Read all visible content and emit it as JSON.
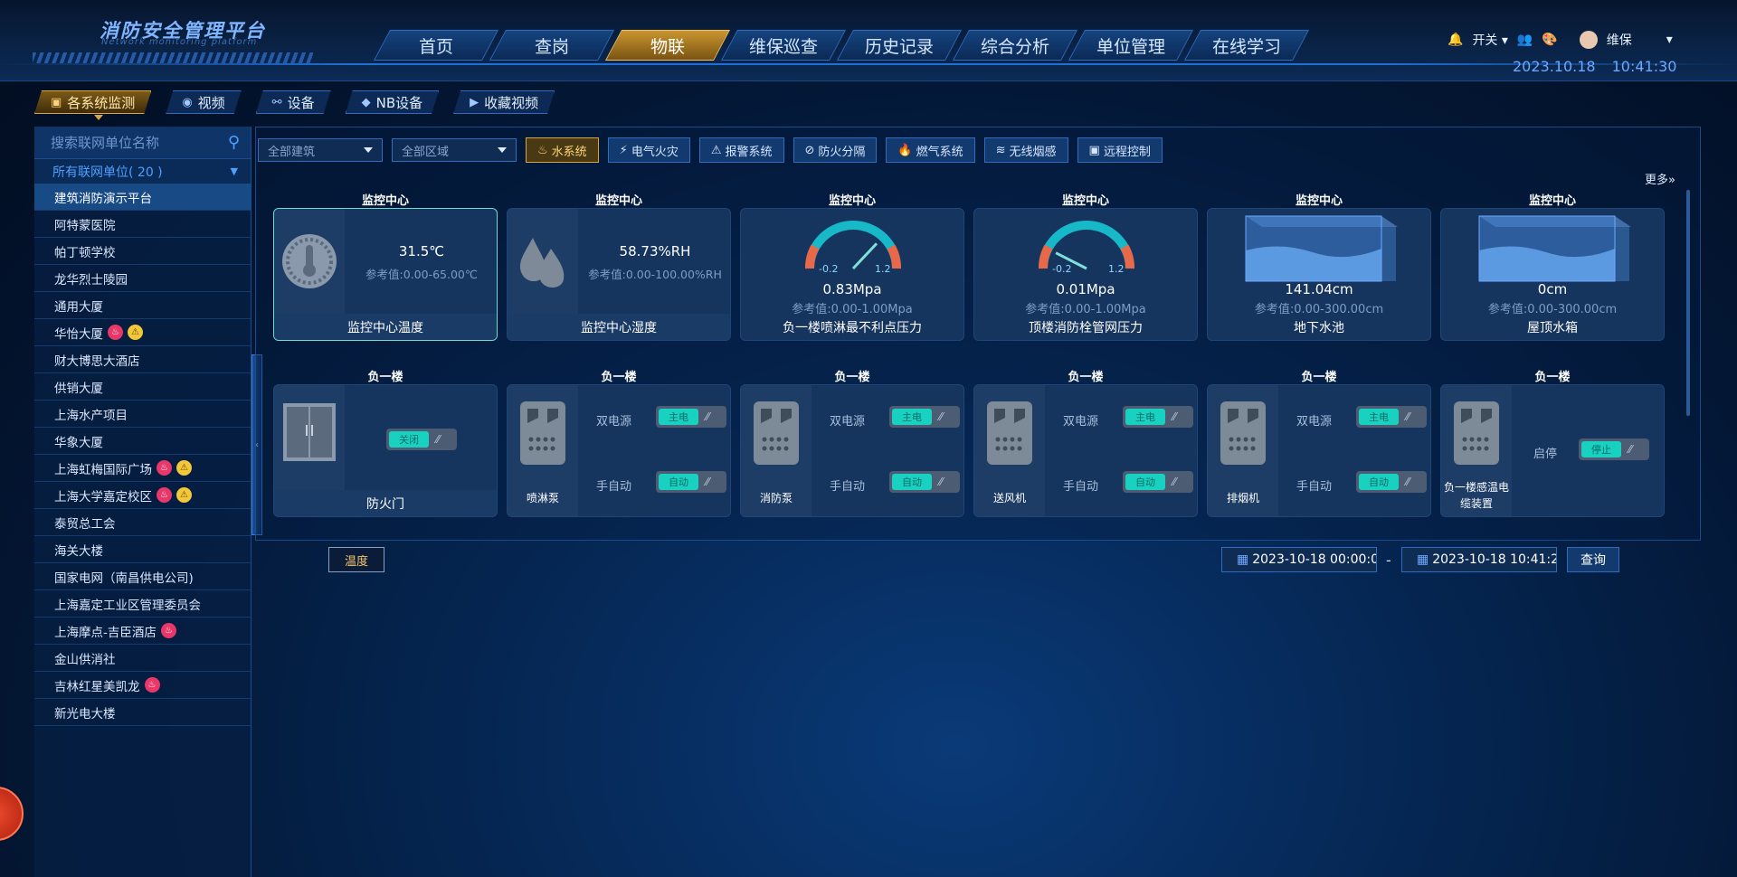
{
  "header": {
    "title": "消防安全管理平台",
    "subtitle": "Network monitoring platform",
    "user": "维保",
    "switch_label": "开关",
    "date": "2023.10.18",
    "time": "10:41:30"
  },
  "nav": [
    {
      "label": "首页"
    },
    {
      "label": "查岗"
    },
    {
      "label": "物联",
      "active": true
    },
    {
      "label": "维保巡查"
    },
    {
      "label": "历史记录"
    },
    {
      "label": "综合分析"
    },
    {
      "label": "单位管理"
    },
    {
      "label": "在线学习"
    }
  ],
  "tabs": [
    {
      "label": "各系统监测",
      "icon": "monitor-icon",
      "active": true
    },
    {
      "label": "视频",
      "icon": "camera-icon"
    },
    {
      "label": "设备",
      "icon": "network-icon"
    },
    {
      "label": "NB设备",
      "icon": "cube-icon"
    },
    {
      "label": "收藏视频",
      "icon": "video-icon"
    }
  ],
  "sidebar": {
    "search_placeholder": "搜索联网单位名称",
    "group_label": "所有联网单位( 20 )",
    "units": [
      {
        "name": "建筑消防演示平台",
        "selected": true,
        "badges": []
      },
      {
        "name": "阿特蒙医院",
        "badges": []
      },
      {
        "name": "帕丁顿学校",
        "badges": []
      },
      {
        "name": "龙华烈士陵园",
        "badges": []
      },
      {
        "name": "通用大厦",
        "badges": []
      },
      {
        "name": "华怡大厦",
        "badges": [
          "fire",
          "warn"
        ]
      },
      {
        "name": "财大博思大酒店",
        "badges": []
      },
      {
        "name": "供销大厦",
        "badges": []
      },
      {
        "name": "上海水产项目",
        "badges": []
      },
      {
        "name": "华象大厦",
        "badges": []
      },
      {
        "name": "上海虹梅国际广场",
        "badges": [
          "fire",
          "warn"
        ]
      },
      {
        "name": "上海大学嘉定校区",
        "badges": [
          "fire",
          "warn"
        ]
      },
      {
        "name": "泰贸总工会",
        "badges": []
      },
      {
        "name": "海关大楼",
        "badges": []
      },
      {
        "name": "国家电网（南昌供电公司)",
        "badges": []
      },
      {
        "name": "上海嘉定工业区管理委员会",
        "badges": []
      },
      {
        "name": "上海摩点-吉臣酒店",
        "badges": [
          "fire"
        ]
      },
      {
        "name": "金山供消社",
        "badges": []
      },
      {
        "name": "吉林红星美凯龙",
        "badges": [
          "fire"
        ]
      },
      {
        "name": "新光电大楼",
        "badges": []
      }
    ]
  },
  "filters": {
    "building": "全部建筑",
    "area": "全部区域",
    "systems": [
      {
        "label": "水系统",
        "active": true
      },
      {
        "label": "电气火灾"
      },
      {
        "label": "报警系统"
      },
      {
        "label": "防火分隔"
      },
      {
        "label": "燃气系统"
      },
      {
        "label": "无线烟感"
      },
      {
        "label": "远程控制"
      }
    ],
    "more": "更多"
  },
  "cards_row1": [
    {
      "location": "监控中心",
      "kind": "icon",
      "icon": "thermometer-icon",
      "value": "31.5℃",
      "ref": "参考值:0.00-65.00℃",
      "name": "监控中心温度"
    },
    {
      "location": "监控中心",
      "kind": "icon",
      "icon": "humidity-icon",
      "value": "58.73%RH",
      "ref": "参考值:0.00-100.00%RH",
      "name": "监控中心湿度"
    },
    {
      "location": "监控中心",
      "kind": "gauge",
      "gauge_min": "-0.2",
      "gauge_max": "1.2",
      "level": 0.74,
      "value": "0.83Mpa",
      "ref": "参考值:0.00-1.00Mpa",
      "name": "负一楼喷淋最不利点压力"
    },
    {
      "location": "监控中心",
      "kind": "gauge",
      "gauge_min": "-0.2",
      "gauge_max": "1.2",
      "level": 0.15,
      "value": "0.01Mpa",
      "ref": "参考值:0.00-1.00Mpa",
      "name": "顶楼消防栓管网压力"
    },
    {
      "location": "监控中心",
      "kind": "tank",
      "value": "141.04cm",
      "ref": "参考值:0.00-300.00cm",
      "name": "地下水池"
    },
    {
      "location": "监控中心",
      "kind": "tank",
      "value": "0cm",
      "ref": "参考值:0.00-300.00cm",
      "name": "屋顶水箱"
    }
  ],
  "cards_row2": [
    {
      "location": "负一楼",
      "kind": "door",
      "toggle": "关闭",
      "name": "防火门"
    },
    {
      "location": "负一楼",
      "kind": "device",
      "device": "喷淋泵",
      "l1": "双电源",
      "t1": "主电",
      "l2": "手自动",
      "t2": "自动"
    },
    {
      "location": "负一楼",
      "kind": "device",
      "device": "消防泵",
      "l1": "双电源",
      "t1": "主电",
      "l2": "手自动",
      "t2": "自动"
    },
    {
      "location": "负一楼",
      "kind": "device",
      "device": "送风机",
      "l1": "双电源",
      "t1": "主电",
      "l2": "手自动",
      "t2": "自动"
    },
    {
      "location": "负一楼",
      "kind": "device",
      "device": "排烟机",
      "l1": "双电源",
      "t1": "主电",
      "l2": "手自动",
      "t2": "自动"
    },
    {
      "location": "负一楼",
      "kind": "single",
      "device": "负一楼感温电缆装置",
      "l1": "启停",
      "t1": "停止"
    }
  ],
  "bottom": {
    "metric_button": "温度",
    "start": "2023-10-18 00:00:0",
    "end": "2023-10-18 10:41:2",
    "dash": "-",
    "query": "查询"
  },
  "colors": {
    "accent": "#d9a441",
    "toggle_on": "#19d1c0",
    "fire": "#e8386a",
    "warn": "#f2c73a"
  }
}
